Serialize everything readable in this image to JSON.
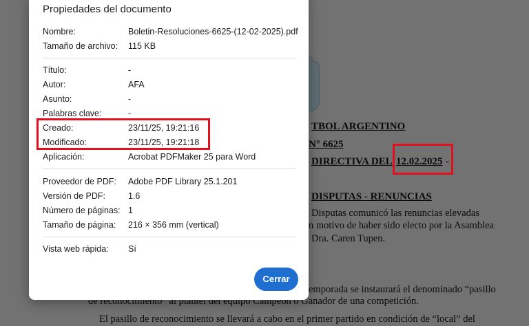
{
  "dialog": {
    "title": "Propiedades del documento",
    "close_button": "Cerrar",
    "sections": [
      [
        {
          "label": "Nombre:",
          "value": "Boletin-Resoluciones-6625-(12-02-2025).pdf"
        },
        {
          "label": "Tamaño de archivo:",
          "value": "115 KB"
        }
      ],
      [
        {
          "label": "Título:",
          "value": "-"
        },
        {
          "label": "Autor:",
          "value": "AFA"
        },
        {
          "label": "Asunto:",
          "value": "-"
        },
        {
          "label": "Palabras clave:",
          "value": "-"
        },
        {
          "label": "Creado:",
          "value": "23/11/25, 19:21:16"
        },
        {
          "label": "Modificado:",
          "value": "23/11/25, 19:21:18"
        },
        {
          "label": "Aplicación:",
          "value": "Acrobat PDFMaker 25 para Word"
        }
      ],
      [
        {
          "label": "Proveedor de PDF:",
          "value": "Adobe PDF Library 25.1.201"
        },
        {
          "label": "Versión de PDF:",
          "value": "1.6"
        },
        {
          "label": "Número de páginas:",
          "value": "1"
        },
        {
          "label": "Tamaño de página:",
          "value": "216 × 356 mm (vertical)"
        }
      ],
      [
        {
          "label": "Vista web rápida:",
          "value": "Sí"
        }
      ]
    ]
  },
  "document": {
    "heading1": "TBOL ARGENTINO",
    "heading2": "N° 6625",
    "heading3": "DIRECTIVA DEL",
    "date": "12.02.2025",
    "dash": "-",
    "section": "DISPUTAS - RENUNCIAS",
    "p1_line1": "Disputas comunicó las renuncias elevadas",
    "p1_line2": "n motivo de haber sido electo por la Asamblea",
    "p1_line3": "Dra. Caren Tupen.",
    "p2_line1": "emporada se instaurará el denominado “pasillo",
    "p2_line2": "de reconocimiento” al plantel del equipo Campeón ó Ganador de una competición.",
    "p3_line1": "El pasillo de reconocimiento se llevará a cabo en el primer partido en condición de “local” del"
  },
  "colors": {
    "highlight": "#e0101e",
    "button": "#1f6fd1",
    "backdrop": "#727272"
  }
}
